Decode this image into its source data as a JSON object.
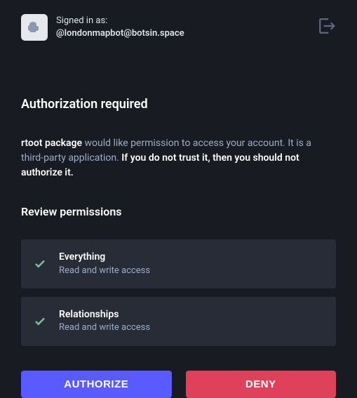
{
  "header": {
    "signed_in_label": "Signed in as:",
    "username": "@londonmapbot@botsin.space"
  },
  "auth": {
    "title": "Authorization required",
    "app_name": "rtoot package",
    "desc_mid": " would like permission to access your account. It is a third-party application. ",
    "warning": "If you do not trust it, then you should not authorize it."
  },
  "review": {
    "title": "Review permissions",
    "permissions": [
      {
        "name": "Everything",
        "desc": "Read and write access"
      },
      {
        "name": "Relationships",
        "desc": "Read and write access"
      }
    ]
  },
  "buttons": {
    "authorize": "AUTHORIZE",
    "deny": "DENY"
  }
}
